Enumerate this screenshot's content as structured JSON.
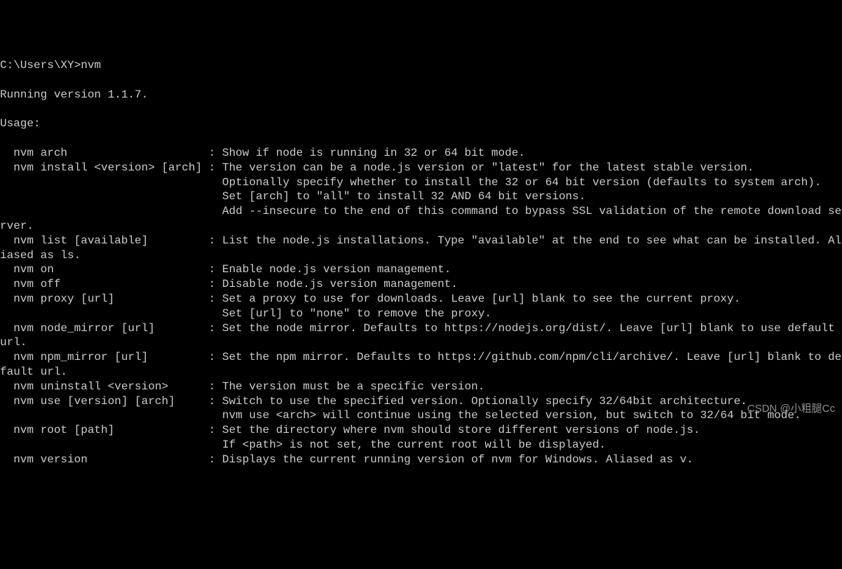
{
  "prompt": "C:\\Users\\XY>",
  "command": "nvm",
  "blank1": "",
  "version_line": "Running version 1.1.7.",
  "blank2": "",
  "usage_header": "Usage:",
  "blank3": "",
  "lines": {
    "arch": "  nvm arch                     : Show if node is running in 32 or 64 bit mode.",
    "install1": "  nvm install <version> [arch] : The version can be a node.js version or \"latest\" for the latest stable version.",
    "install2": "                                 Optionally specify whether to install the 32 or 64 bit version (defaults to system arch).",
    "install3": "                                 Set [arch] to \"all\" to install 32 AND 64 bit versions.",
    "install4": "                                 Add --insecure to the end of this command to bypass SSL validation of the remote download server.",
    "list": "  nvm list [available]         : List the node.js installations. Type \"available\" at the end to see what can be installed. Aliased as ls.",
    "on": "  nvm on                       : Enable node.js version management.",
    "off": "  nvm off                      : Disable node.js version management.",
    "proxy1": "  nvm proxy [url]              : Set a proxy to use for downloads. Leave [url] blank to see the current proxy.",
    "proxy2": "                                 Set [url] to \"none\" to remove the proxy.",
    "node_mirror": "  nvm node_mirror [url]        : Set the node mirror. Defaults to https://nodejs.org/dist/. Leave [url] blank to use default url.",
    "npm_mirror": "  nvm npm_mirror [url]         : Set the npm mirror. Defaults to https://github.com/npm/cli/archive/. Leave [url] blank to default url.",
    "uninstall": "  nvm uninstall <version>      : The version must be a specific version.",
    "use1": "  nvm use [version] [arch]     : Switch to use the specified version. Optionally specify 32/64bit architecture.",
    "use2": "                                 nvm use <arch> will continue using the selected version, but switch to 32/64 bit mode.",
    "root1": "  nvm root [path]              : Set the directory where nvm should store different versions of node.js.",
    "root2": "                                 If <path> is not set, the current root will be displayed.",
    "version": "  nvm version                  : Displays the current running version of nvm for Windows. Aliased as v."
  },
  "watermark": "CSDN @小粗腿Cc"
}
